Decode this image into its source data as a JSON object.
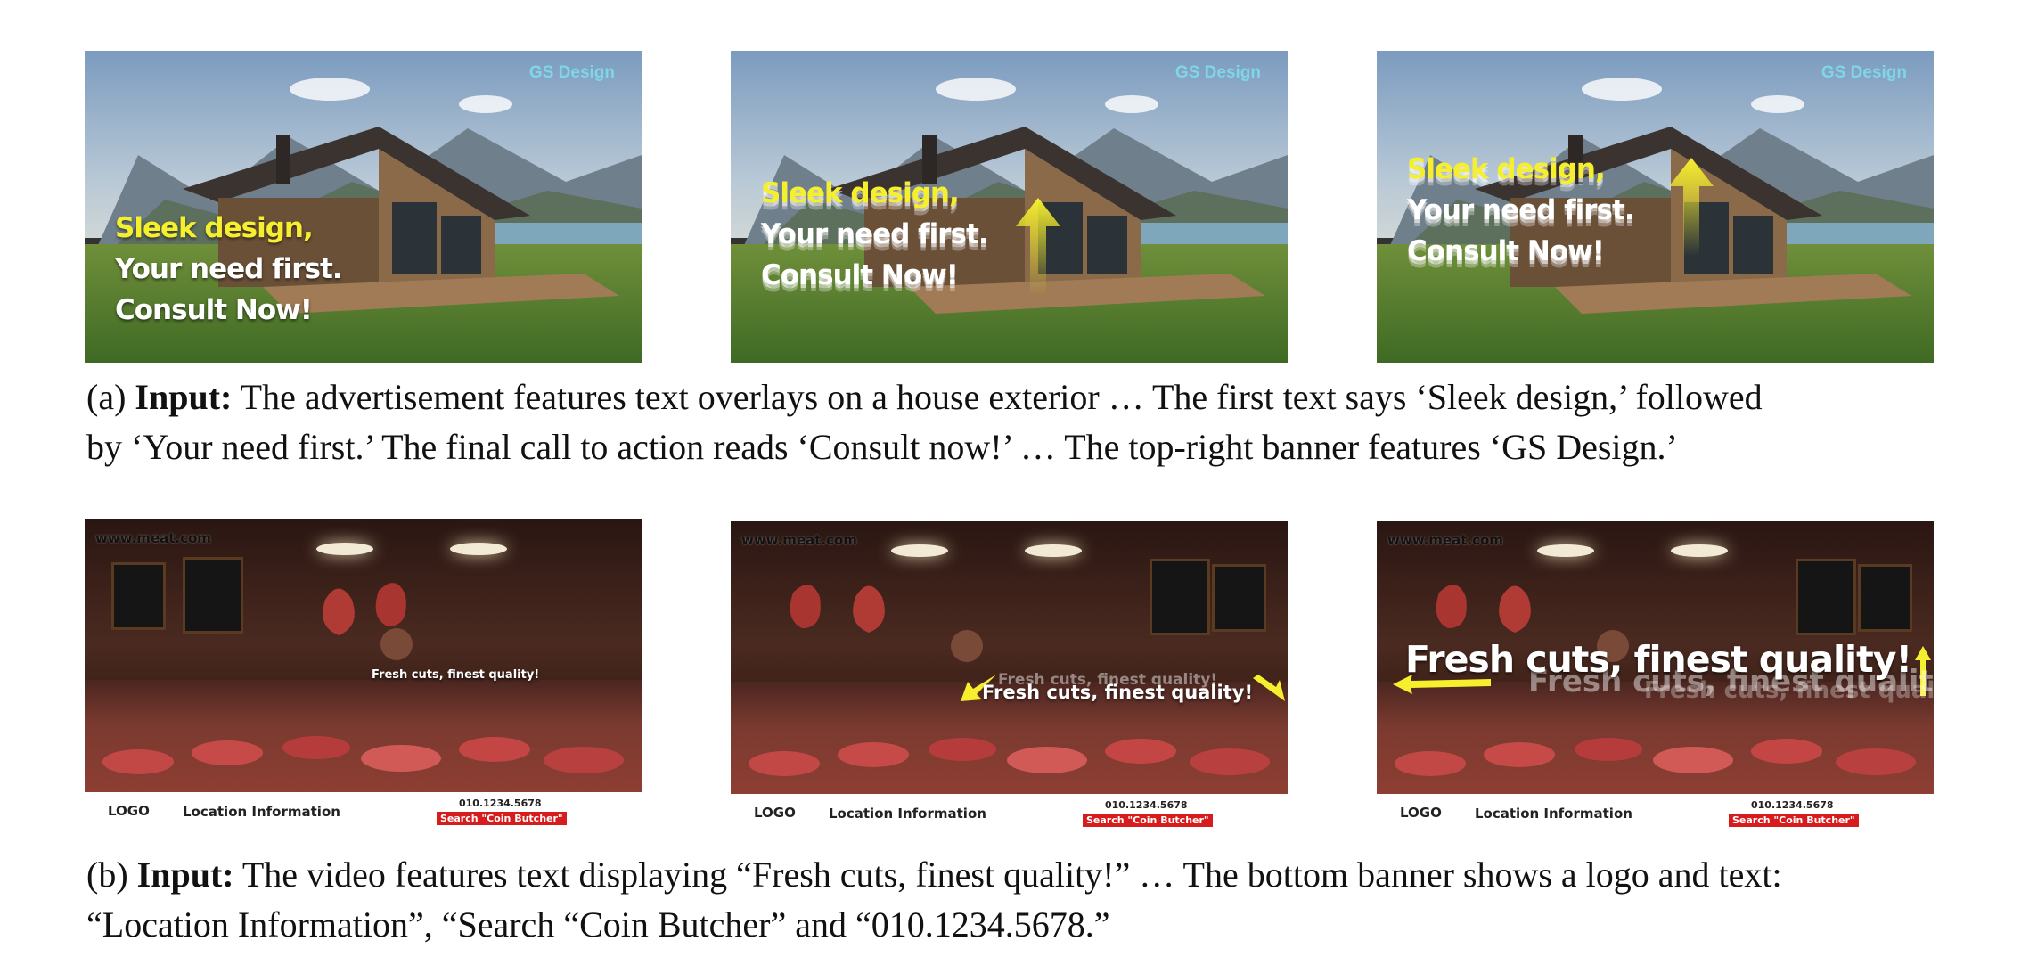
{
  "brand": "GS Design",
  "house_ad": {
    "line1": "Sleek design,",
    "line2": "Your need first.",
    "line3": "Consult Now!"
  },
  "butcher_ad": {
    "url": "www.meat.com",
    "headline": "Fresh cuts, finest quality!",
    "logo": "LOGO",
    "location": "Location Information",
    "phone": "010.1234.5678",
    "search": "Search \"Coin Butcher\""
  },
  "captions": {
    "a": {
      "prefix": "(a) ",
      "label": "Input:",
      "line1": " The advertisement features text overlays on a house exterior … The first text says ‘Sleek design,’ followed",
      "line2": "by ‘Your need first.’ The final call to action reads ‘Consult now!’ … The top-right banner features ‘GS Design.’"
    },
    "b": {
      "prefix": "(b) ",
      "label": "Input:",
      "line1": " The video features text displaying “Fresh cuts, finest quality!” … The bottom banner shows a logo and text:",
      "line2": "“Location Information”, “Search “Coin Butcher” and “010.1234.5678.”"
    }
  },
  "colors": {
    "headline_yellow": "#f6ef2e",
    "brand_cyan": "#7fd6e6",
    "search_red": "#d61c1c"
  }
}
